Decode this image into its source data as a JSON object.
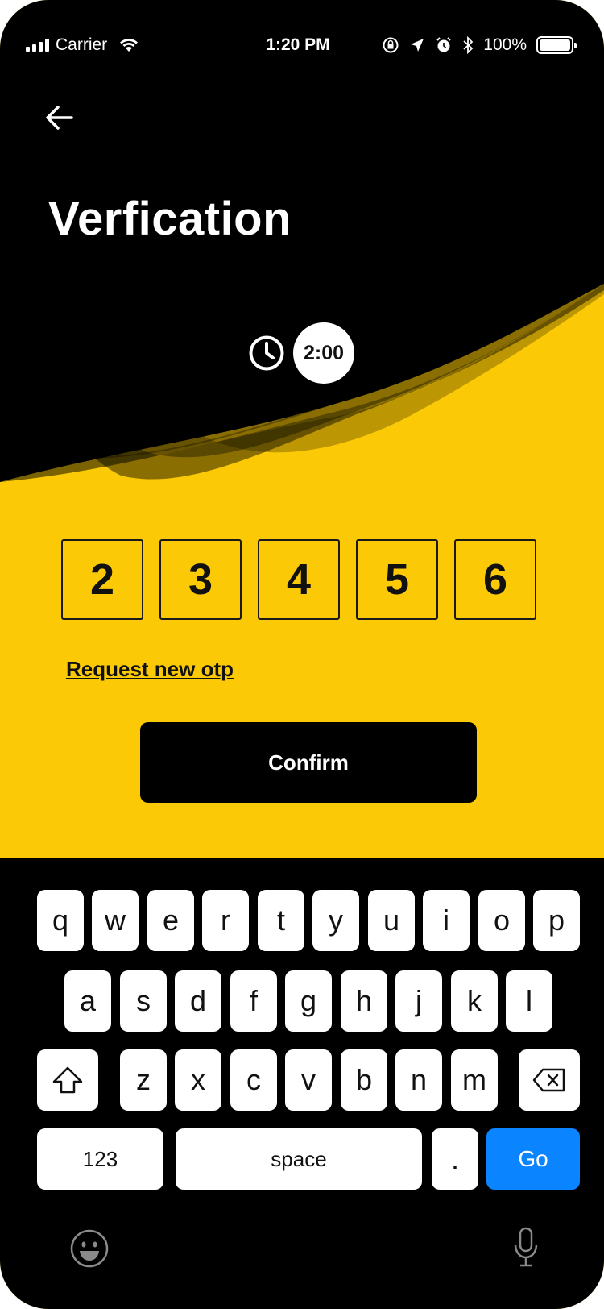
{
  "status_bar": {
    "carrier": "Carrier",
    "time": "1:20 PM",
    "battery": "100%"
  },
  "header": {
    "back_icon": "arrow-left-icon",
    "title": "Verfication"
  },
  "timer": {
    "icon": "clock-icon",
    "value": "2:00"
  },
  "otp": {
    "digits": [
      "2",
      "3",
      "4",
      "5",
      "6"
    ]
  },
  "actions": {
    "request_link": "Request new otp",
    "confirm_label": "Confirm"
  },
  "keyboard": {
    "row1": [
      "q",
      "w",
      "e",
      "r",
      "t",
      "y",
      "u",
      "i",
      "o",
      "p"
    ],
    "row2": [
      "a",
      "s",
      "d",
      "f",
      "g",
      "h",
      "j",
      "k",
      "l"
    ],
    "row3": [
      "z",
      "x",
      "c",
      "v",
      "b",
      "n",
      "m"
    ],
    "numbers_label": "123",
    "space_label": "space",
    "period_label": ".",
    "go_label": "Go",
    "shift_icon": "shift-icon",
    "delete_icon": "delete-icon",
    "emoji_icon": "emoji-icon",
    "mic_icon": "microphone-icon"
  },
  "colors": {
    "accent_yellow": "#fbc905",
    "dark": "#000000",
    "go_blue": "#0a84ff"
  }
}
